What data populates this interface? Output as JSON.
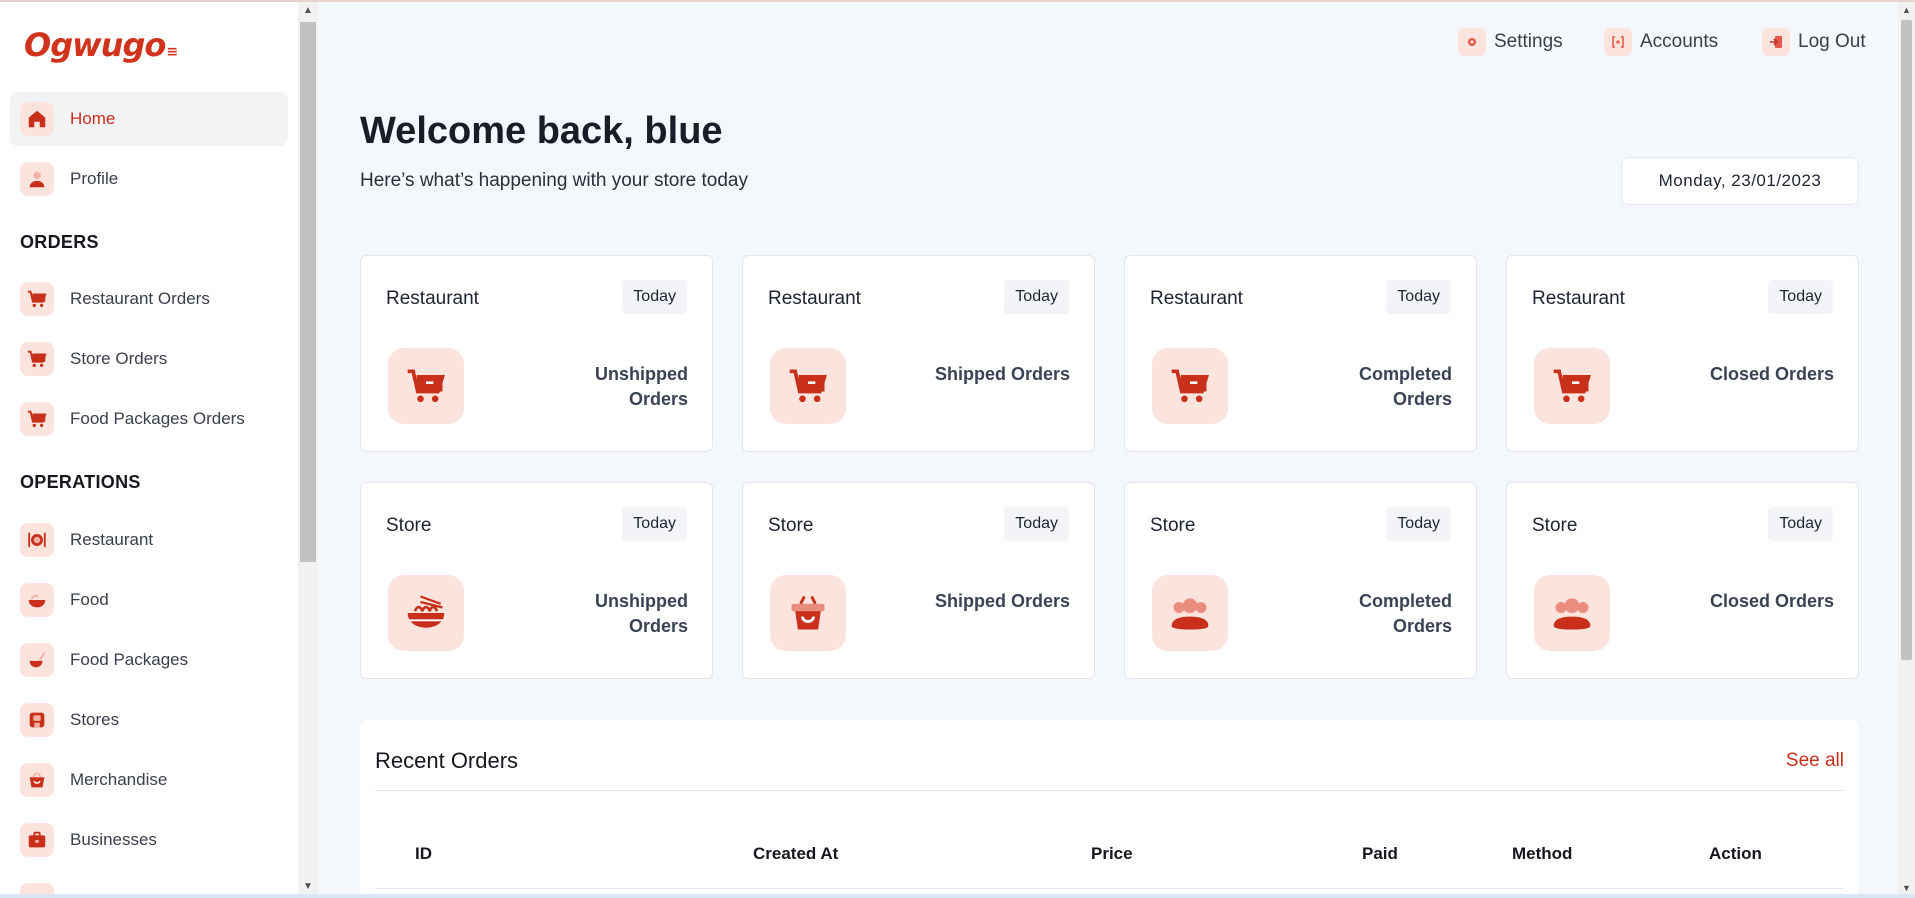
{
  "brand": {
    "logo_text": "Ogwugo",
    "accent": "#d0321c",
    "icon_bg": "#fbe3de"
  },
  "sidebar": {
    "items_top": [
      {
        "label": "Home",
        "icon": "home-icon",
        "active": true
      },
      {
        "label": "Profile",
        "icon": "user-icon",
        "active": false
      }
    ],
    "orders_heading": "ORDERS",
    "orders_items": [
      {
        "label": "Restaurant Orders",
        "icon": "cart-icon"
      },
      {
        "label": "Store Orders",
        "icon": "cart-icon"
      },
      {
        "label": "Food Packages Orders",
        "icon": "cart-icon"
      }
    ],
    "operations_heading": "OPERATIONS",
    "operations_items": [
      {
        "label": "Restaurant",
        "icon": "cutlery-icon"
      },
      {
        "label": "Food",
        "icon": "food-bowl-icon"
      },
      {
        "label": "Food Packages",
        "icon": "food-package-icon"
      },
      {
        "label": "Stores",
        "icon": "store-icon"
      },
      {
        "label": "Merchandise",
        "icon": "basket-icon"
      },
      {
        "label": "Businesses",
        "icon": "briefcase-icon"
      }
    ]
  },
  "topbar": {
    "settings_label": "Settings",
    "accounts_label": "Accounts",
    "logout_label": "Log Out"
  },
  "header": {
    "welcome": "Welcome back, blue",
    "subtitle": "Here’s what’s happening with your store today",
    "date": "Monday, 23/01/2023"
  },
  "cards": [
    {
      "title": "Restaurant",
      "badge": "Today",
      "label": "Unshipped Orders",
      "icon": "cart-icon"
    },
    {
      "title": "Restaurant",
      "badge": "Today",
      "label": "Shipped Orders",
      "icon": "cart-icon"
    },
    {
      "title": "Restaurant",
      "badge": "Today",
      "label": "Completed Orders",
      "icon": "cart-icon"
    },
    {
      "title": "Restaurant",
      "badge": "Today",
      "label": "Closed Orders",
      "icon": "cart-icon"
    },
    {
      "title": "Store",
      "badge": "Today",
      "label": "Unshipped Orders",
      "icon": "noodle-bowl-icon"
    },
    {
      "title": "Store",
      "badge": "Today",
      "label": "Shipped Orders",
      "icon": "basket-icon"
    },
    {
      "title": "Store",
      "badge": "Today",
      "label": "Completed Orders",
      "icon": "users-icon"
    },
    {
      "title": "Store",
      "badge": "Today",
      "label": "Closed Orders",
      "icon": "users-icon"
    }
  ],
  "recent_orders": {
    "title": "Recent Orders",
    "see_all": "See all",
    "columns": [
      "ID",
      "Created At",
      "Price",
      "Paid",
      "Method",
      "Action"
    ]
  }
}
